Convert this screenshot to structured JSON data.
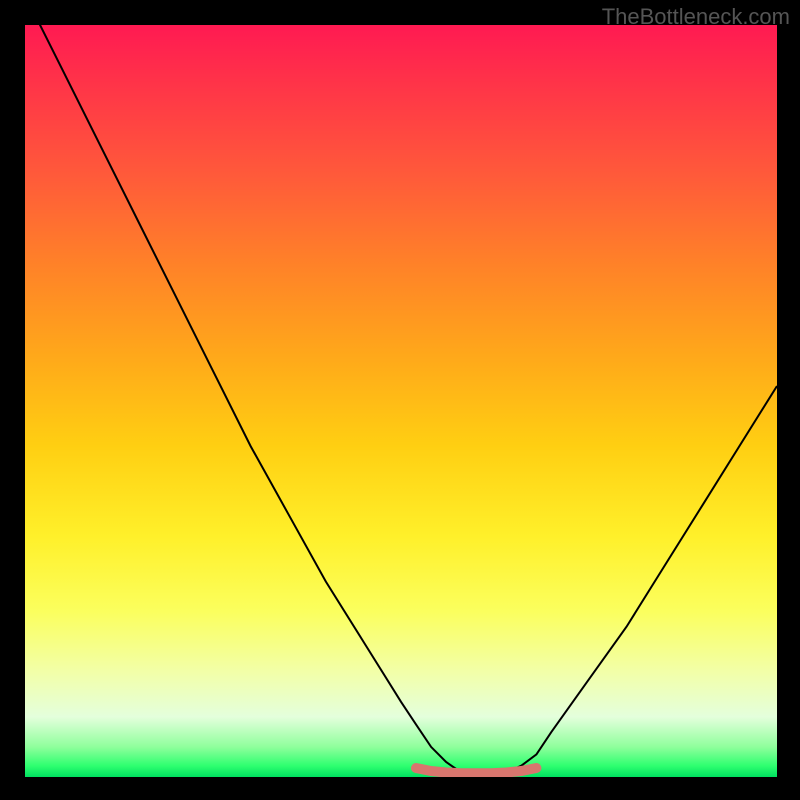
{
  "watermark": "TheBottleneck.com",
  "chart_data": {
    "type": "line",
    "title": "",
    "xlabel": "",
    "ylabel": "",
    "xlim": [
      0,
      100
    ],
    "ylim": [
      0,
      100
    ],
    "note": "Bottleneck curve: V-shape, minimum ~0 near x≈60, rises to ~100 at x=0 and ~50 at x=100",
    "series": [
      {
        "name": "bottleneck-curve",
        "x": [
          0,
          5,
          10,
          15,
          20,
          25,
          30,
          35,
          40,
          45,
          50,
          52,
          54,
          56,
          58,
          60,
          62,
          64,
          66,
          68,
          70,
          75,
          80,
          85,
          90,
          95,
          100
        ],
        "values": [
          104,
          94,
          84,
          74,
          64,
          54,
          44,
          35,
          26,
          18,
          10,
          7,
          4,
          2,
          0.6,
          0.3,
          0.3,
          0.6,
          1.5,
          3,
          6,
          13,
          20,
          28,
          36,
          44,
          52
        ]
      },
      {
        "name": "optimal-zone-marker",
        "x": [
          52,
          54,
          56,
          58,
          60,
          62,
          64,
          66,
          68
        ],
        "values": [
          1.2,
          0.8,
          0.6,
          0.5,
          0.5,
          0.5,
          0.6,
          0.8,
          1.2
        ]
      }
    ],
    "colors": {
      "curve": "#000000",
      "marker": "#d8766e",
      "gradient_top": "#ff1a52",
      "gradient_bottom": "#00e060"
    }
  }
}
